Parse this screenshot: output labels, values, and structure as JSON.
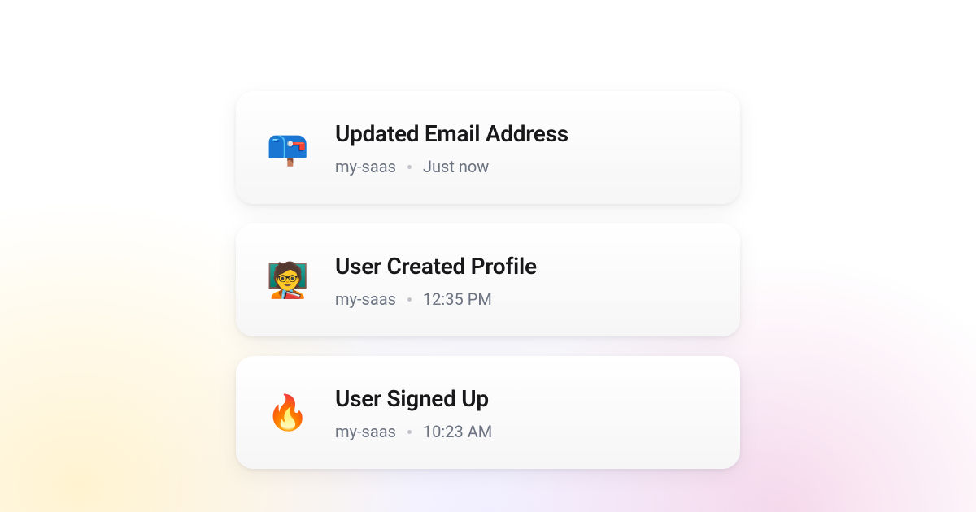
{
  "events": [
    {
      "emoji": "📪",
      "title": "Updated Email Address",
      "source": "my-saas",
      "time": "Just now"
    },
    {
      "emoji": "🧑‍🏫",
      "title": "User Created Profile",
      "source": "my-saas",
      "time": "12:35 PM"
    },
    {
      "emoji": "🔥",
      "title": "User Signed Up",
      "source": "my-saas",
      "time": "10:23 AM"
    }
  ]
}
